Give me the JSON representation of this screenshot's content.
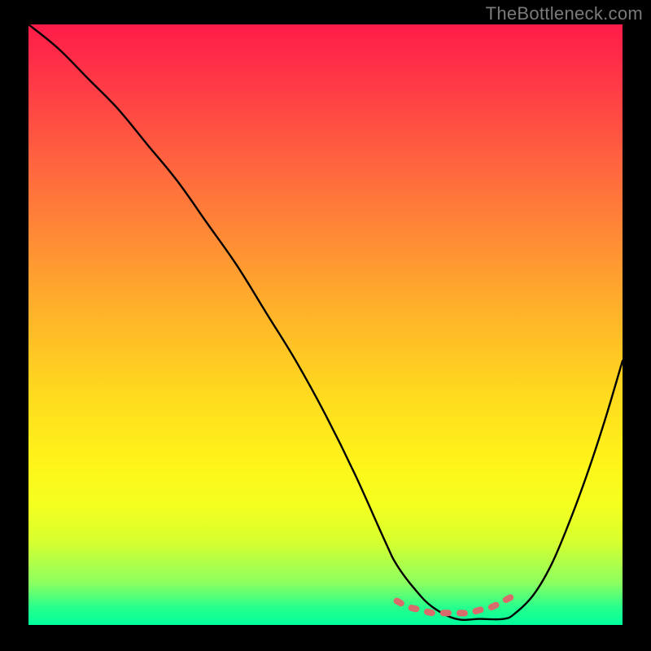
{
  "watermark": "TheBottleneck.com",
  "chart_data": {
    "type": "line",
    "title": "",
    "xlabel": "",
    "ylabel": "",
    "xlim": [
      0,
      100
    ],
    "ylim": [
      0,
      100
    ],
    "gradient_axis": "y",
    "gradient_meaning": "bottleneck severity (top=red=high, bottom=green=low)",
    "series": [
      {
        "name": "bottleneck-curve",
        "x": [
          0,
          5,
          10,
          15,
          20,
          25,
          30,
          35,
          40,
          45,
          50,
          55,
          60,
          62,
          65,
          68,
          72,
          76,
          80,
          82,
          85,
          88,
          91,
          94,
          97,
          100
        ],
        "y": [
          100,
          96,
          91,
          86,
          80,
          74,
          67,
          60,
          52,
          44,
          35,
          25,
          14,
          10,
          6,
          3,
          1,
          1,
          1,
          2,
          5,
          10,
          17,
          25,
          34,
          44
        ]
      },
      {
        "name": "optimal-region-marker",
        "x": [
          62,
          64,
          66,
          68,
          70,
          72,
          74,
          76,
          78,
          80,
          82
        ],
        "y": [
          4,
          3,
          2.5,
          2,
          2,
          2,
          2,
          2.5,
          3,
          4,
          5
        ]
      }
    ]
  }
}
